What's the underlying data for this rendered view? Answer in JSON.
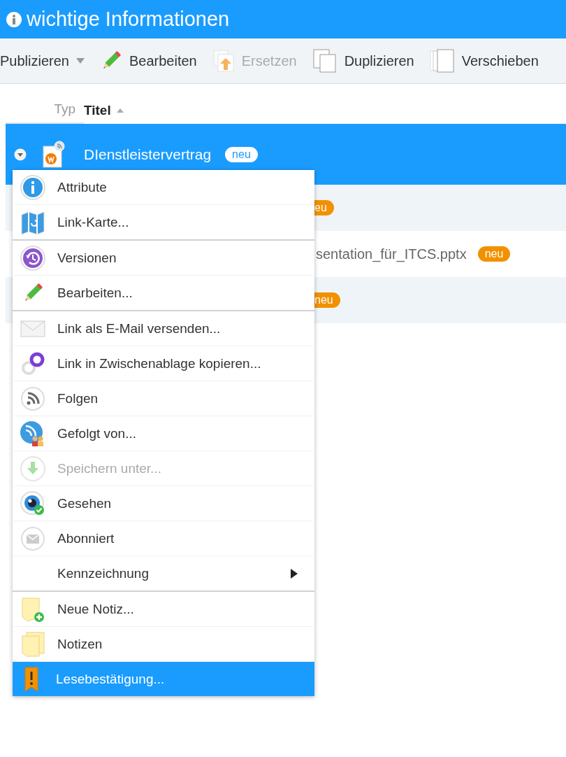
{
  "header": {
    "title": "wichtige Informationen"
  },
  "toolbar": [
    {
      "label": "Publizieren",
      "kind": "dropdown",
      "disabled": false
    },
    {
      "label": "Bearbeiten",
      "kind": "edit",
      "disabled": false
    },
    {
      "label": "Ersetzen",
      "kind": "replace",
      "disabled": true
    },
    {
      "label": "Duplizieren",
      "kind": "duplicate",
      "disabled": false
    },
    {
      "label": "Verschieben",
      "kind": "move",
      "disabled": false
    }
  ],
  "columns": [
    {
      "label": "Typ",
      "sorted": false
    },
    {
      "label": "Titel",
      "sorted": true
    }
  ],
  "rows": [
    {
      "selected": true,
      "title": "DIenstleistervertrag",
      "badge": "neu"
    },
    {
      "selected": false,
      "badge": "eu"
    },
    {
      "selected": false,
      "title": "sentation_für_ITCS.pptx",
      "badge": "neu"
    },
    {
      "selected": false,
      "badge": "neu"
    }
  ],
  "context_menu": {
    "groups": [
      {
        "items": [
          {
            "label": "Attribute",
            "kind": "info",
            "disabled": false,
            "selected": false
          },
          {
            "label": "Link-Karte...",
            "kind": "map",
            "disabled": false,
            "selected": false
          }
        ]
      },
      {
        "items": [
          {
            "label": "Versionen",
            "kind": "versions",
            "disabled": false,
            "selected": false
          },
          {
            "label": "Bearbeiten...",
            "kind": "edit",
            "disabled": false,
            "selected": false
          }
        ]
      },
      {
        "items": [
          {
            "label": "Link als E-Mail versenden...",
            "kind": "mail",
            "disabled": false,
            "selected": false
          },
          {
            "label": "Link in Zwischenablage kopieren...",
            "kind": "link",
            "disabled": false,
            "selected": false
          },
          {
            "label": "Folgen",
            "kind": "follow",
            "disabled": false,
            "selected": false
          },
          {
            "label": "Gefolgt von...",
            "kind": "followers",
            "disabled": false,
            "selected": false
          },
          {
            "label": "Speichern unter...",
            "kind": "save",
            "disabled": true,
            "selected": false
          },
          {
            "label": "Gesehen",
            "kind": "seen",
            "disabled": false,
            "selected": false
          },
          {
            "label": "Abonniert",
            "kind": "subscribed",
            "disabled": false,
            "selected": false
          },
          {
            "label": "Kennzeichnung",
            "kind": "submenu",
            "disabled": false,
            "selected": false
          }
        ]
      },
      {
        "items": [
          {
            "label": "Neue Notiz...",
            "kind": "new-note",
            "disabled": false,
            "selected": false
          },
          {
            "label": "Notizen",
            "kind": "notes",
            "disabled": false,
            "selected": false
          },
          {
            "label": "Lesebestätigung...",
            "kind": "receipt",
            "disabled": false,
            "selected": true
          }
        ]
      }
    ]
  }
}
